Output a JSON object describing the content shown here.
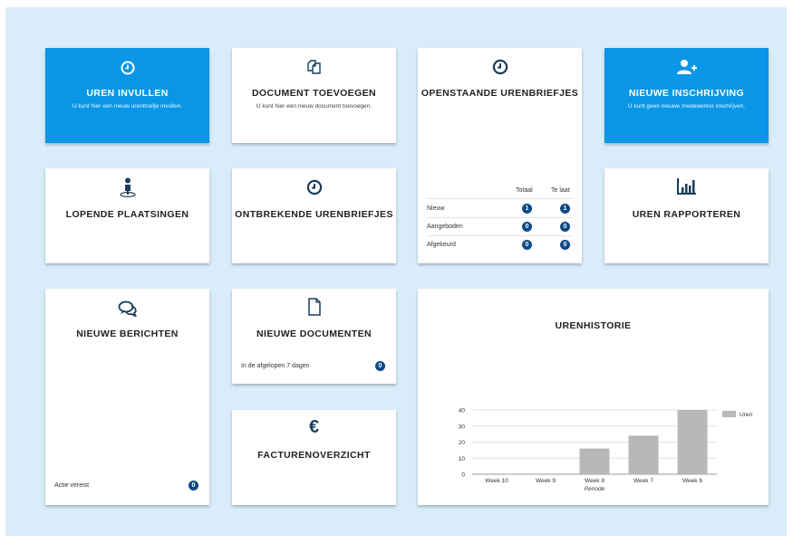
{
  "tiles": {
    "uren_invullen": {
      "title": "UREN INVULLEN",
      "sub": "U kunt hier een nieuw urenbriefje invullen."
    },
    "document_toevoegen": {
      "title": "DOCUMENT TOEVOEGEN",
      "sub": "U kunt hier een nieuw document toevoegen."
    },
    "openstaande": {
      "title": "OPENSTAANDE URENBRIEFJES",
      "col_totaal": "Totaal",
      "col_te_laat": "Te laat",
      "rows": [
        {
          "label": "Nieuw",
          "totaal": "1",
          "te_laat": "1"
        },
        {
          "label": "Aangeboden",
          "totaal": "0",
          "te_laat": "0"
        },
        {
          "label": "Afgekeurd",
          "totaal": "0",
          "te_laat": "0"
        }
      ]
    },
    "nieuwe_inschrijving": {
      "title": "NIEUWE INSCHRIJVING",
      "sub": "U kunt geen nieuwe medewerker inschrijven."
    },
    "lopende_plaatsingen": {
      "title": "LOPENDE PLAATSINGEN"
    },
    "ontbrekende": {
      "title": "ONTBREKENDE URENBRIEFJES"
    },
    "uren_rapporteren": {
      "title": "UREN RAPPORTEREN"
    },
    "nieuwe_berichten": {
      "title": "NIEUWE BERICHTEN",
      "footer_label": "Actie vereist",
      "count": "0"
    },
    "nieuwe_documenten": {
      "title": "NIEUWE DOCUMENTEN",
      "footer_label": "In de afgelopen 7 dagen",
      "count": "0"
    },
    "facturenoverzicht": {
      "title": "FACTURENOVERZICHT",
      "symbol": "€"
    },
    "urenhistorie": {
      "title": "URENHISTORIE"
    }
  },
  "chart_data": {
    "type": "bar",
    "title": "URENHISTORIE",
    "xlabel": "Periode",
    "ylabel": "",
    "categories": [
      "Week 10",
      "Week 9",
      "Week 8",
      "Week 7",
      "Week 6"
    ],
    "series": [
      {
        "name": "Uren",
        "values": [
          0,
          0,
          16,
          24,
          40
        ]
      }
    ],
    "ylim": [
      0,
      40
    ],
    "yticks": [
      0,
      10,
      20,
      30,
      40
    ],
    "grid": true,
    "legend": "right",
    "bar_color": "#b9b7b9"
  },
  "colors": {
    "accent": "#0a96e6",
    "badge": "#0c4a86",
    "background": "#d8edf9"
  }
}
